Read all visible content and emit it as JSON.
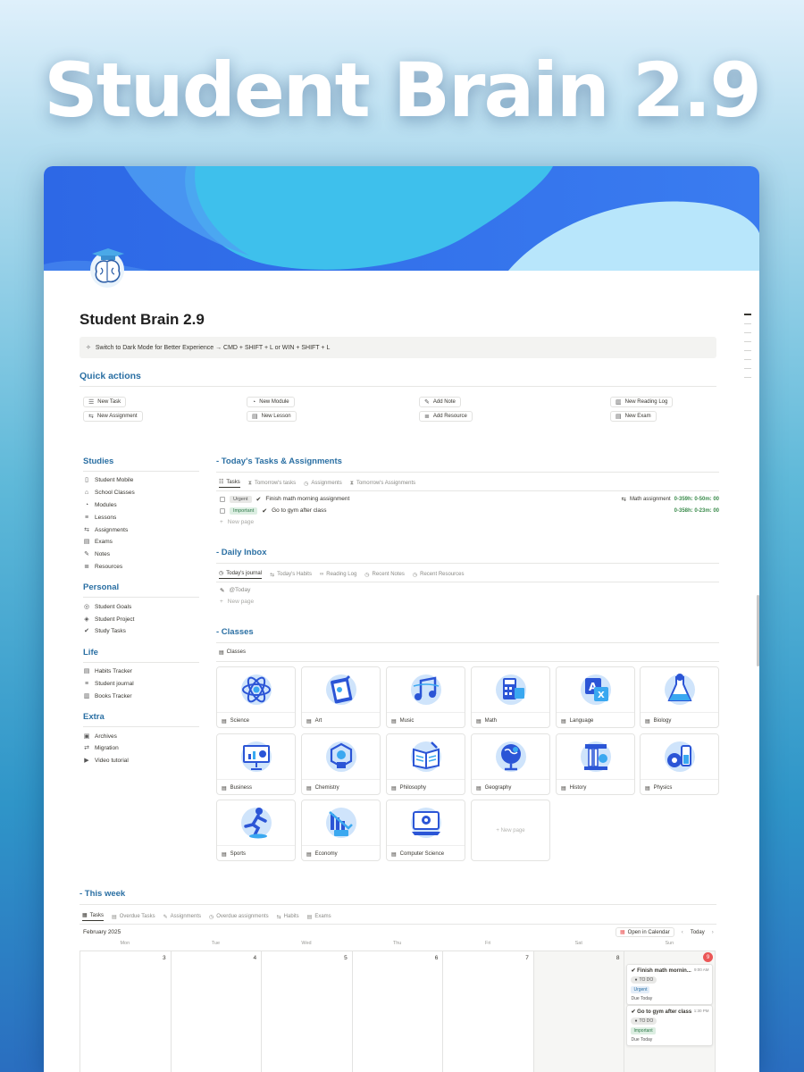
{
  "promo_title": "Student Brain 2.9",
  "page": {
    "title": "Student Brain 2.9",
    "callout": "Switch to Dark Mode for Better Experience → CMD + SHIFT + L or WIN + SHIFT + L"
  },
  "quick_actions": {
    "heading": "Quick actions",
    "items": [
      {
        "label": "New Task",
        "icon": "checklist-icon"
      },
      {
        "label": "New Assignment",
        "icon": "repeat-icon"
      },
      {
        "label": "New Module",
        "icon": "pie-icon"
      },
      {
        "label": "New Lesson",
        "icon": "document-icon"
      },
      {
        "label": "Add Note",
        "icon": "edit-icon"
      },
      {
        "label": "Add Resource",
        "icon": "list-icon"
      },
      {
        "label": "New Reading Log",
        "icon": "book-icon"
      },
      {
        "label": "New Exam",
        "icon": "document-icon"
      }
    ]
  },
  "sidebar": {
    "sections": [
      {
        "heading": "Studies",
        "items": [
          "Student Mobile",
          "School Classes",
          "Modules",
          "Lessons",
          "Assignments",
          "Exams",
          "Notes",
          "Resources"
        ]
      },
      {
        "heading": "Personal",
        "items": [
          "Student Goals",
          "Student Project",
          "Study Tasks"
        ]
      },
      {
        "heading": "Life",
        "items": [
          "Habits Tracker",
          "Student journal",
          "Books Tracker"
        ]
      },
      {
        "heading": "Extra",
        "items": [
          "Archives",
          "Migration",
          "Video tutorial"
        ]
      }
    ]
  },
  "tasks_section": {
    "heading": "- Today's Tasks & Assignments",
    "tabs": [
      "Tasks",
      "Tomorrow's tasks",
      "Assignments",
      "Tomorrow's Assignments"
    ],
    "rows": [
      {
        "tag": "Urgent",
        "title": "Finish math morning assignment",
        "relation": "Math assignment",
        "timer": "0-359h: 0-50m: 00"
      },
      {
        "tag": "Important",
        "title": "Go to gym after class",
        "relation": "",
        "timer": "0-358h: 0-23m: 00"
      }
    ],
    "new_page": "New page"
  },
  "inbox_section": {
    "heading": "- Daily Inbox",
    "tabs": [
      "Today's journal",
      "Today's Habits",
      "Reading Log",
      "Recent Notes",
      "Recent Resources"
    ],
    "entry": "@Today",
    "new_page": "New page"
  },
  "classes_section": {
    "heading": "- Classes",
    "view_label": "Classes",
    "cards": [
      "Science",
      "Art",
      "Music",
      "Math",
      "Language",
      "Biology",
      "Business",
      "Chemistry",
      "Philosophy",
      "Geography",
      "History",
      "Physics",
      "Sports",
      "Economy",
      "Computer Science"
    ],
    "new_page": "New page"
  },
  "week_section": {
    "heading": "- This week",
    "tabs": [
      "Tasks",
      "Overdue Tasks",
      "Assignments",
      "Overdue assignments",
      "Habits",
      "Exams"
    ],
    "month": "February 2025",
    "open_calendar": "Open in Calendar",
    "today_btn": "Today",
    "days": [
      "Mon",
      "Tue",
      "Wed",
      "Thu",
      "Fri",
      "Sat",
      "Sun"
    ],
    "dates": [
      "3",
      "4",
      "5",
      "6",
      "7",
      "8",
      "9"
    ],
    "events": [
      {
        "title": "Finish math mornin...",
        "time": "9:00 AM",
        "status": "TO DO",
        "tag": "Urgent",
        "due": "Due Today"
      },
      {
        "title": "Go to gym after class",
        "time": "1:30 PM",
        "status": "TO DO",
        "tag": "Important",
        "due": "Due Today"
      }
    ]
  },
  "colors": {
    "accent": "#2a6fa3",
    "today": "#eb5757",
    "cover_blue": "#2f6fe0"
  }
}
